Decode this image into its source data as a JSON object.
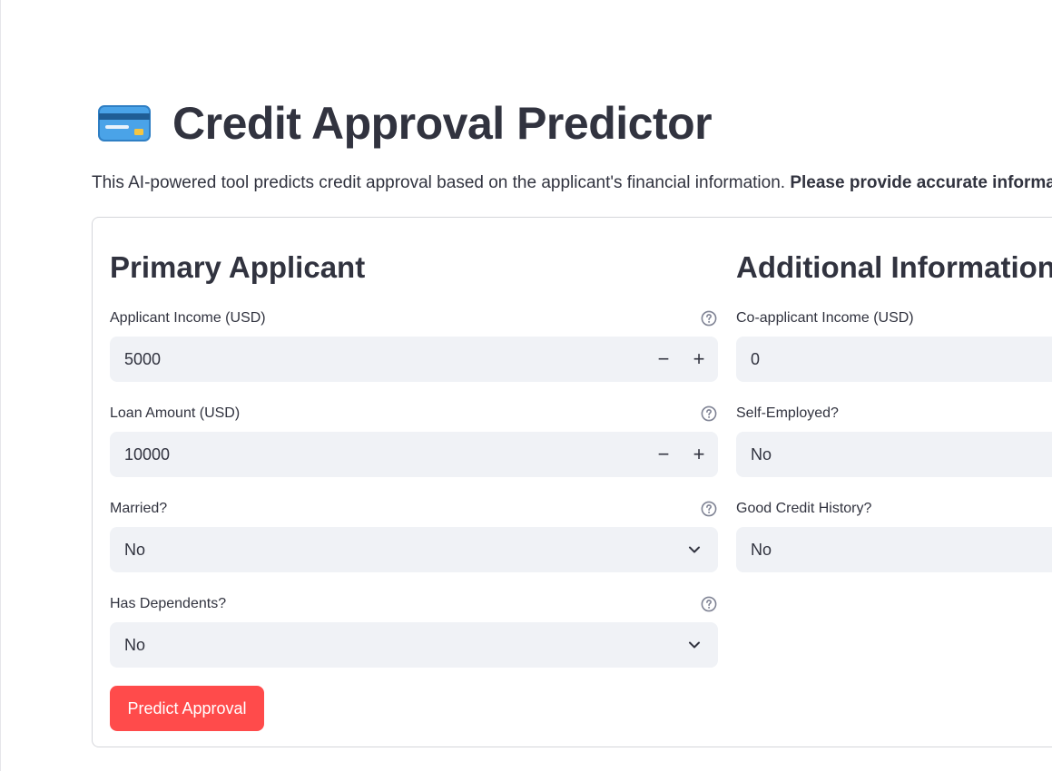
{
  "page": {
    "title": "Credit Approval Predictor",
    "title_icon": "credit-card-icon",
    "intro_text": "This AI-powered tool predicts credit approval based on the applicant's financial information. ",
    "intro_bold": "Please provide accurate informati"
  },
  "primary": {
    "heading": "Primary Applicant",
    "applicant_income": {
      "label": "Applicant Income (USD)",
      "value": "5000",
      "minus": "−",
      "plus": "+"
    },
    "loan_amount": {
      "label": "Loan Amount (USD)",
      "value": "10000",
      "minus": "−",
      "plus": "+"
    },
    "married": {
      "label": "Married?",
      "value": "No"
    },
    "dependents": {
      "label": "Has Dependents?",
      "value": "No"
    }
  },
  "additional": {
    "heading": "Additional Information",
    "coapplicant_income": {
      "label": "Co-applicant Income (USD)",
      "value": "0"
    },
    "self_employed": {
      "label": "Self-Employed?",
      "value": "No"
    },
    "credit_history": {
      "label": "Good Credit History?",
      "value": "No"
    }
  },
  "actions": {
    "predict_label": "Predict Approval"
  },
  "colors": {
    "accent": "#ff4b4b",
    "input_bg": "#f0f2f6",
    "text": "#31333f"
  }
}
